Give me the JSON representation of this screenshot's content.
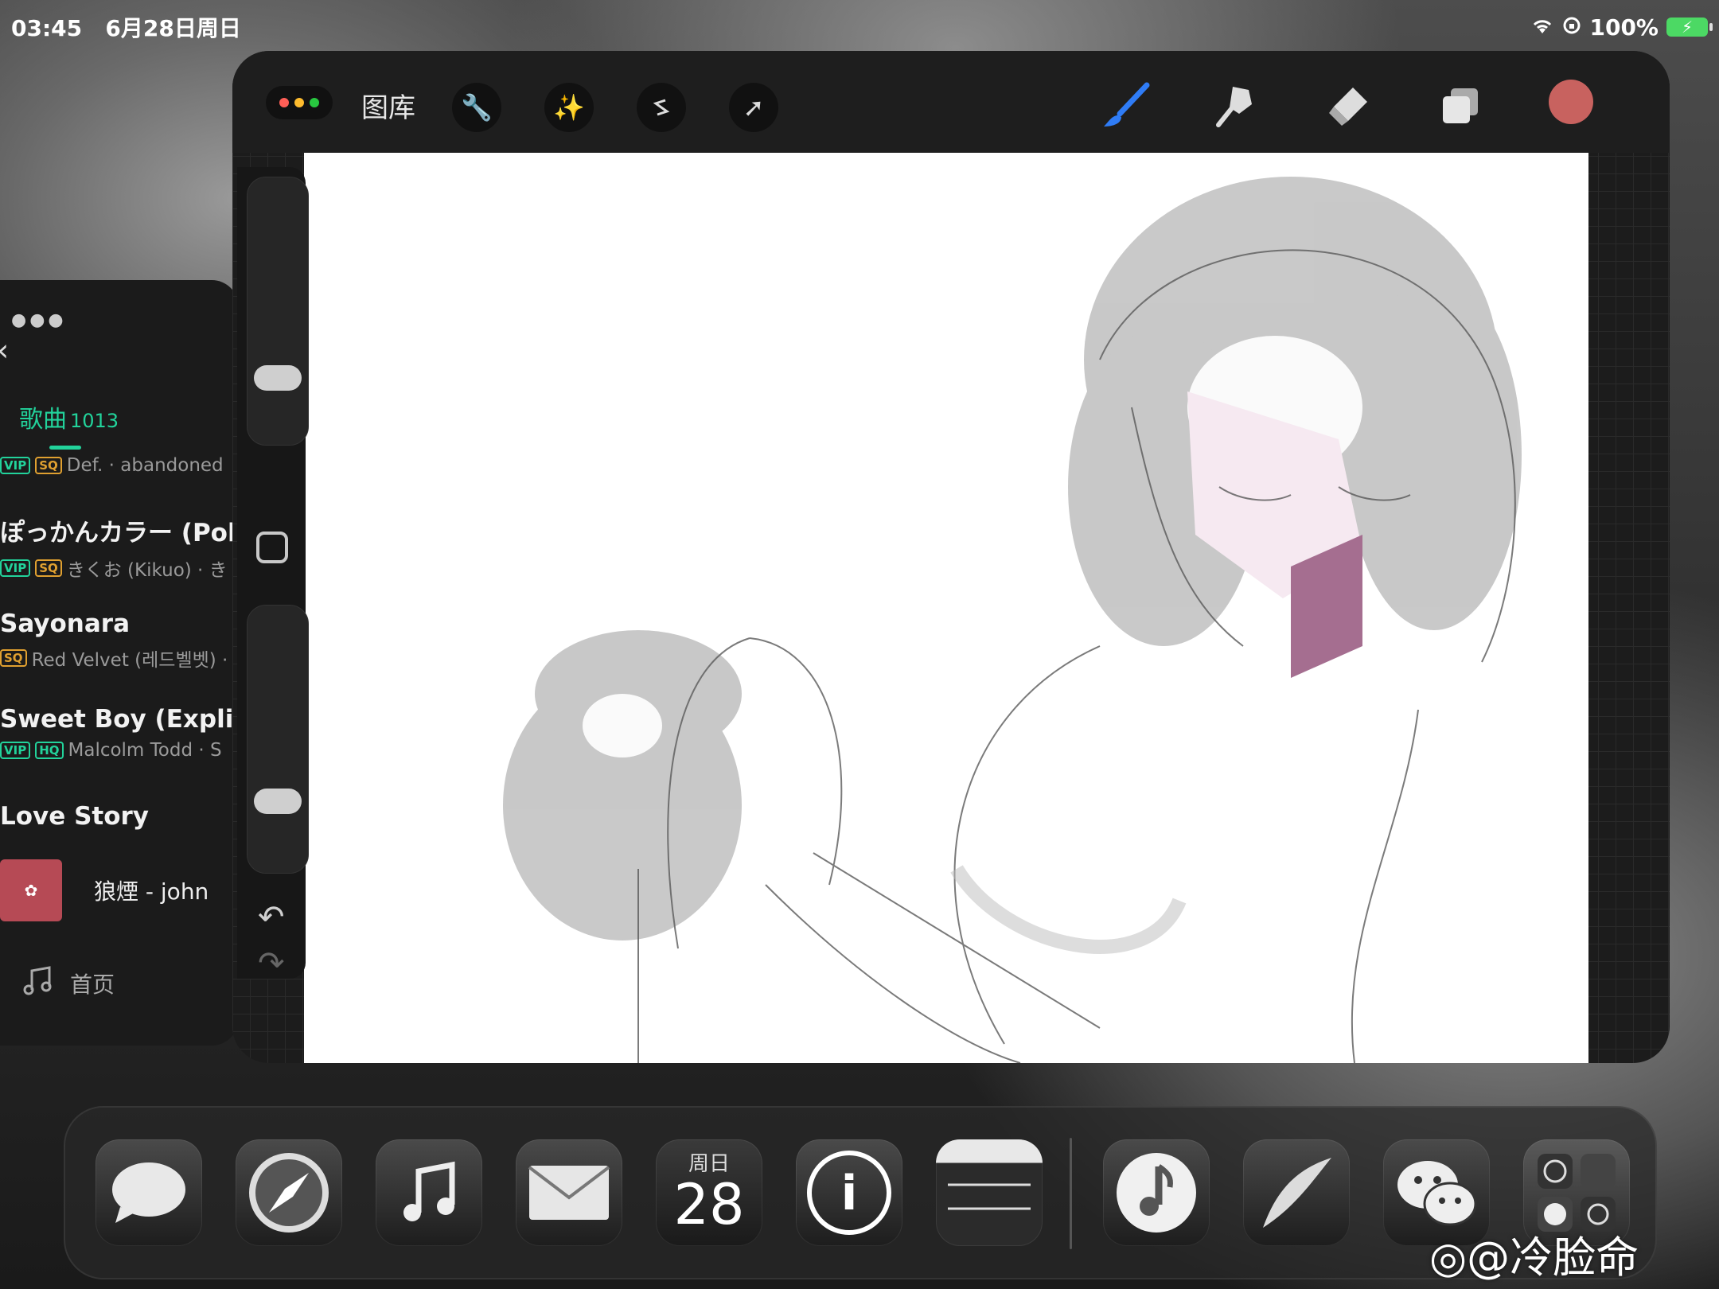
{
  "status": {
    "time": "03:45",
    "date": "6月28日周日",
    "battery": "100%"
  },
  "music": {
    "tab_label": "歌曲",
    "tab_count": "1013",
    "songs": [
      {
        "title": "",
        "artist": "Def. · abandoned",
        "tags": [
          "VIP",
          "SQ"
        ]
      },
      {
        "title": "ぽっかんカラー (Pokk",
        "artist": "きくお (Kikuo) · き",
        "tags": [
          "VIP",
          "SQ"
        ]
      },
      {
        "title": "Sayonara",
        "artist": "Red Velvet (레드벨벳) ·",
        "tags": [
          "SQ"
        ]
      },
      {
        "title": "Sweet Boy (Explicit)",
        "artist": "Malcolm Todd · S",
        "tags": [
          "VIP",
          "HQ"
        ]
      },
      {
        "title": "Love Story",
        "artist": "",
        "tags": []
      }
    ],
    "now_playing": "狼煙 - john",
    "home_label": "首页"
  },
  "procreate": {
    "gallery_label": "图库",
    "color": "#c8625f"
  },
  "dock": {
    "calendar_day": "周日",
    "calendar_date": "28"
  },
  "watermark": "@冷脸命"
}
